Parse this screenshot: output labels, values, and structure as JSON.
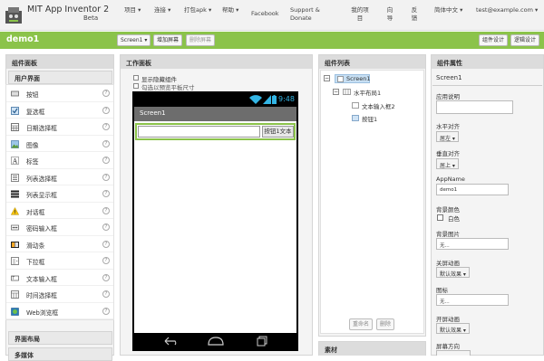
{
  "header": {
    "app_title": "MIT App Inventor 2",
    "app_subtitle": "Beta",
    "menu": [
      "项目",
      "连接",
      "打包apk",
      "帮助",
      "Facebook",
      "Support &",
      "Donate",
      "我的项目",
      "向导",
      "反馈",
      "简体中文",
      "test@example.com"
    ]
  },
  "project_bar": {
    "project_name": "demo1",
    "screen_select": "Screen1",
    "add_screen": "增加屏幕",
    "remove_screen": "删除屏幕",
    "designer": "组件设计",
    "blocks": "逻辑设计"
  },
  "palette": {
    "title": "组件面板",
    "category_ui": "用户界面",
    "items": [
      "按钮",
      "复选框",
      "日期选择框",
      "图像",
      "标签",
      "列表选择框",
      "列表显示框",
      "对话框",
      "密码输入框",
      "滑动条",
      "下拉框",
      "文本输入框",
      "时间选择框",
      "Web浏览框"
    ],
    "category_layout": "界面布局",
    "category_media": "多媒体"
  },
  "viewer": {
    "title": "工作面板",
    "show_hidden": "显示隐藏组件",
    "preview_tablet": "勾选以预览平板尺寸",
    "status_time": "9:48",
    "screen_title": "Screen1",
    "button_text": "按钮1文本"
  },
  "components": {
    "title": "组件列表",
    "tree": [
      "Screen1",
      "水平布局1",
      "文本输入框2",
      "按钮1"
    ],
    "rename": "重命名",
    "delete": "删除",
    "media_title": "素材"
  },
  "properties": {
    "title": "组件属性",
    "component": "Screen1",
    "about_label": "应用说明",
    "halign_label": "水平对齐",
    "halign_value": "居左",
    "valign_label": "垂直对齐",
    "valign_value": "居上",
    "appname_label": "AppName",
    "appname_value": "demo1",
    "bgcolor_label": "背景颜色",
    "bgcolor_value": "白色",
    "bgimage_label": "背景图片",
    "bgimage_value": "无...",
    "close_anim_label": "关屏动画",
    "close_anim_value": "默认效果",
    "icon_label": "图标",
    "icon_value": "无...",
    "open_anim_label": "开屏动画",
    "open_anim_value": "默认效果",
    "orientation_label": "屏幕方向"
  },
  "colors": {
    "accent": "#8bc34a",
    "status_bar": "#000000",
    "title_bar": "#6d6d6d",
    "wifi": "#33b5e5"
  }
}
